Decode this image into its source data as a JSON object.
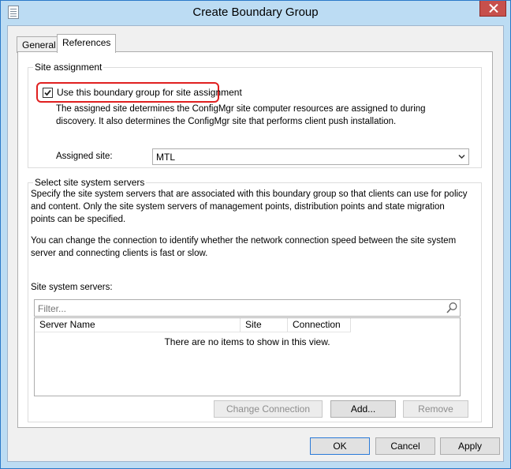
{
  "window": {
    "title": "Create Boundary Group"
  },
  "tabs": [
    {
      "label": "General",
      "active": false
    },
    {
      "label": "References",
      "active": true
    }
  ],
  "site_assignment": {
    "group_title": "Site assignment",
    "checkbox_label": "Use this boundary group for site assignment",
    "checkbox_checked": true,
    "description": "The assigned site determines the ConfigMgr site computer resources are assigned to during discovery. It also determines the ConfigMgr site that performs client push installation.",
    "assigned_site_label": "Assigned site:",
    "assigned_site_value": "MTL"
  },
  "site_system_servers": {
    "group_title": "Select site system servers",
    "description1": "Specify the site system servers that are associated with this boundary group so that clients can use for policy and content. Only the site system servers of management points, distribution points and state migration points can be specified.",
    "description2": "You can change the connection to identify whether the network connection speed between the site system server and connecting clients is fast or slow.",
    "list_label": "Site system servers:",
    "filter_placeholder": "Filter...",
    "columns": [
      "Server Name",
      "Site",
      "Connection"
    ],
    "empty_message": "There are no items to show in this view.",
    "buttons": {
      "change_connection": "Change Connection",
      "add": "Add...",
      "remove": "Remove"
    }
  },
  "footer": {
    "ok": "OK",
    "cancel": "Cancel",
    "apply": "Apply"
  },
  "colors": {
    "title_bar": "#bcdcf3",
    "close_button": "#c7504c",
    "highlight_outline": "#e02020"
  }
}
